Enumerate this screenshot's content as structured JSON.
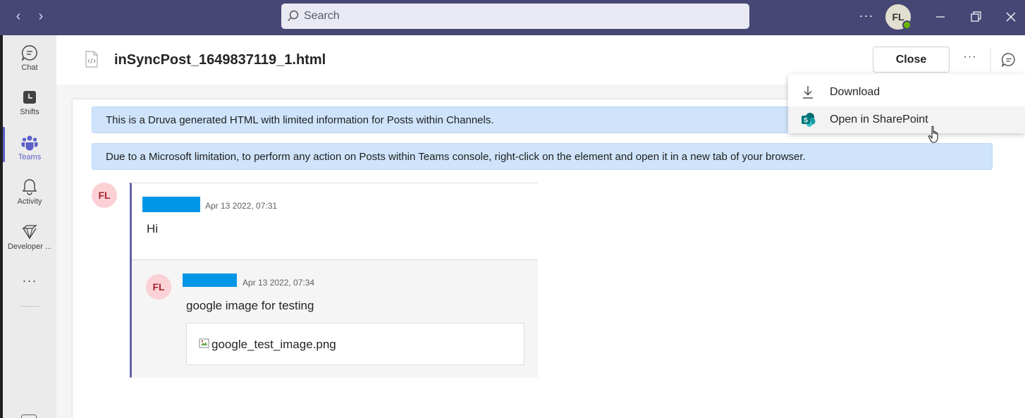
{
  "titlebar": {
    "search_placeholder": "Search",
    "more_icon": "more-horizontal-icon",
    "avatar_initials": "FL",
    "presence_color": "#6bb700"
  },
  "rail": {
    "items": [
      {
        "label": "Chat",
        "icon": "chat-icon"
      },
      {
        "label": "Shifts",
        "icon": "shifts-icon"
      },
      {
        "label": "Teams",
        "icon": "teams-icon",
        "active": true
      },
      {
        "label": "Activity",
        "icon": "bell-icon"
      },
      {
        "label": "Developer ...",
        "icon": "developer-portal-icon"
      }
    ],
    "more": "···"
  },
  "header": {
    "file_name": "inSyncPost_1649837119_1.html",
    "close_label": "Close"
  },
  "menu": {
    "items": [
      {
        "label": "Download",
        "icon": "download-icon"
      },
      {
        "label": "Open in SharePoint",
        "icon": "sharepoint-icon"
      }
    ]
  },
  "content": {
    "banners": [
      "This is a Druva generated HTML with limited information for Posts within Channels.",
      "Due to a Microsoft limitation, to perform any action on Posts within Teams console, right-click on the element and open it in a new tab of your browser."
    ],
    "post": {
      "avatar": "FL",
      "timestamp": "Apr 13 2022, 07:31",
      "message": "Hi",
      "reply": {
        "avatar": "FL",
        "timestamp": "Apr 13 2022, 07:34",
        "message": "google image for testing",
        "attachment": "google_test_image.png"
      }
    }
  },
  "colors": {
    "titlebar": "#464775",
    "accent": "#5b5fc7",
    "banner": "#cfe4fa",
    "redacted_name": "#0096e6",
    "avatar_bg": "#fbd1d6",
    "avatar_text": "#a4262c"
  }
}
